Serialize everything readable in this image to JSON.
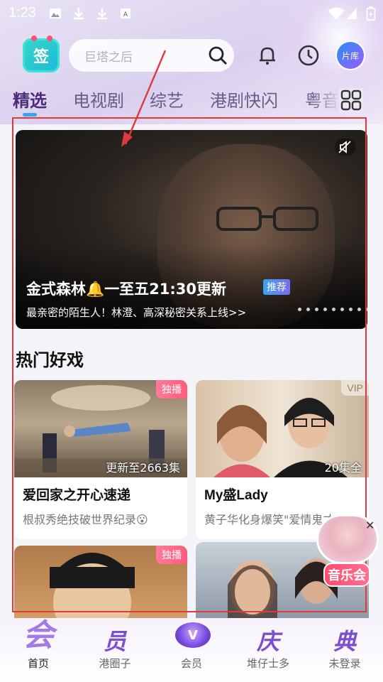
{
  "status_bar": {
    "time": "1:23"
  },
  "header": {
    "sign_label": "签",
    "search_placeholder": "巨塔之后",
    "library_label": "片库"
  },
  "tabs": [
    {
      "label": "精选",
      "active": true
    },
    {
      "label": "电视剧"
    },
    {
      "label": "综艺"
    },
    {
      "label": "港剧快闪"
    },
    {
      "label": "粤音"
    }
  ],
  "banner": {
    "title": "金式森林🔔一至五21:30更新",
    "tag": "推荐",
    "subtitle": "最亲密的陌生人！林澄、高深秘密关系上线>>",
    "dot_count": 9
  },
  "section": {
    "title": "热门好戏"
  },
  "cards": [
    {
      "badge": "独播",
      "count": "更新至2663集",
      "title": "爱回家之开心速递",
      "desc": "根叔秀绝技破世界纪录😮"
    },
    {
      "badge": "VIP",
      "count": "20集全",
      "title": "My盛Lady",
      "desc": "黄子华化身爆笑\"爱情鬼才\""
    },
    {
      "badge": "独播"
    },
    {
      "badge": ""
    }
  ],
  "floating_promo": {
    "label": "音乐会"
  },
  "bottom_nav": [
    {
      "glyph": "会",
      "label": "首页",
      "active": true
    },
    {
      "glyph": "员",
      "label": "港圈子"
    },
    {
      "glyph": "V",
      "label": "会员"
    },
    {
      "glyph": "庆",
      "label": "堆仔士多"
    },
    {
      "glyph": "典",
      "label": "未登录"
    }
  ],
  "colors": {
    "accent": "#3aa4f0",
    "brand_purple": "#7c4fd0",
    "badge_red": "#ff5c7c",
    "annotation_red": "#e0393b"
  }
}
